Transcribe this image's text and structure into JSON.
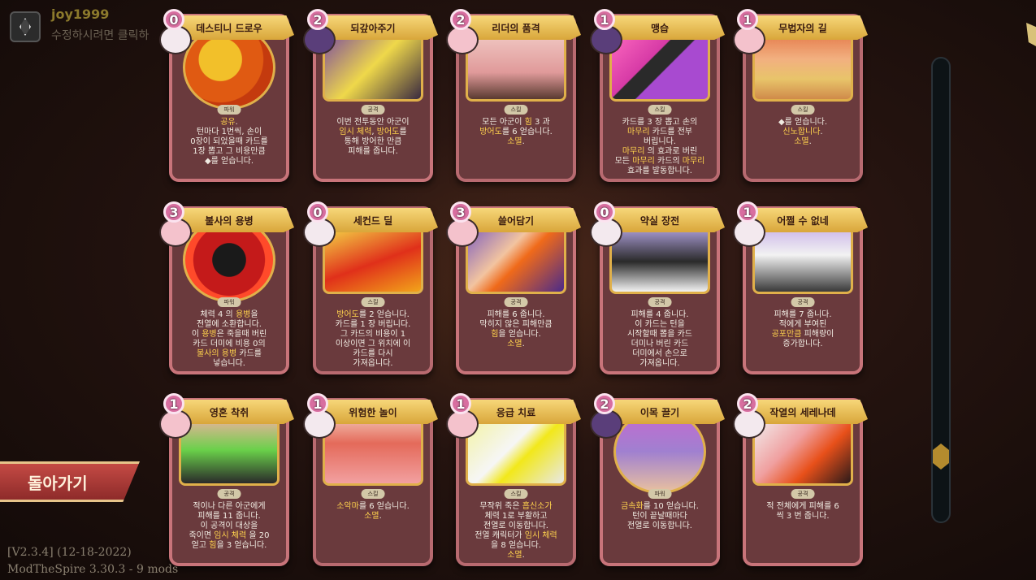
{
  "user": {
    "name": "joy1999",
    "hint": "수정하시려면 클릭하"
  },
  "back_button": "돌아가기",
  "version": {
    "line1": "[V2.3.4] (12-18-2022)",
    "line2": "ModTheSpire 3.30.3 - 9 mods"
  },
  "cards": [
    {
      "title": "데스티니 드로우",
      "cost": "0",
      "type": "파워",
      "desc_lines": [
        "<span class=\"hl\">공유</span>.",
        "턴마다 1번씩, 손이",
        "0장이 되었을때 카드를",
        "1장 뽑고 그 비용만큼",
        "◆를 얻습니다."
      ]
    },
    {
      "title": "되갚아주기",
      "cost": "2",
      "type": "공격",
      "desc_lines": [
        "이번 전투동안 아군이",
        "<span class=\"hl\">임시 체력</span>, <span class=\"hl\">방어도</span>를",
        "통해 방어한 만큼",
        "피해를 줍니다."
      ]
    },
    {
      "title": "리더의 품격",
      "cost": "2",
      "type": "스킬",
      "desc_lines": [
        "모든 아군이 <span class=\"hl\">힘</span> 3 과",
        "<span class=\"hl\">방어도</span>를 6 얻습니다.",
        "<span class=\"hl\">소멸</span>."
      ]
    },
    {
      "title": "맹습",
      "cost": "1",
      "type": "스킬",
      "desc_lines": [
        "카드를 3 장 뽑고 손의",
        "<span class=\"hl\">마무리</span> 카드를 전부",
        "버립니다.",
        "<span class=\"hl\">마무리</span> 의 효과로 버린",
        "모든 <span class=\"hl\">마무리</span> 카드의 <span class=\"hl\">마무리</span>",
        "효과를 발동합니다."
      ]
    },
    {
      "title": "무법자의 길",
      "cost": "1",
      "type": "스킬",
      "desc_lines": [
        "◆를 얻습니다.",
        "<span class=\"hl\">신노합니다</span>.",
        "<span class=\"hl\">소멸</span>."
      ]
    },
    {
      "title": "불사의 용병",
      "cost": "3",
      "type": "파워",
      "desc_lines": [
        "체력 4 의 <span class=\"hl\">용병</span>을",
        "전열에 소환합니다.",
        "이 <span class=\"hl\">용병</span>은 죽을때 버린",
        "카드 더미에 비용 0의",
        "<span class=\"hl\">불사의 용병</span> 카드를",
        "넣습니다."
      ]
    },
    {
      "title": "세컨드 딜",
      "cost": "0",
      "type": "스킬",
      "desc_lines": [
        "<span class=\"hl\">방어도</span>를 2 얻습니다.",
        "카드를 1 장 버립니다.",
        "그 카드의 비용이 1",
        "이상이면 그 위치에 이",
        "카드를 다시",
        "가져옵니다."
      ]
    },
    {
      "title": "쓸어담기",
      "cost": "3",
      "type": "공격",
      "desc_lines": [
        "피해를 6 줍니다.",
        "막히지 않은 피해만큼",
        "<span class=\"hl\">힘</span>을 얻습니다.",
        "<span class=\"hl\">소멸</span>."
      ]
    },
    {
      "title": "약실 장전",
      "cost": "0",
      "type": "공격",
      "desc_lines": [
        "피해를 4 줍니다.",
        "이 카드는 턴을",
        "시작할때 뽑을 카드",
        "더미나 버린 카드",
        "더미에서 손으로",
        "가져옵니다."
      ]
    },
    {
      "title": "어쩔 수 없네",
      "cost": "1",
      "type": "공격",
      "desc_lines": [
        "피해를 7 줍니다.",
        "적에게 부여된",
        "<span class=\"hl\">공포만큼</span> 피해량이",
        "증가합니다."
      ]
    },
    {
      "title": "영혼 착취",
      "cost": "1",
      "type": "공격",
      "desc_lines": [
        "적이나 다른 아군에게",
        "피해를 11 줍니다.",
        "이 공격이 대상을",
        "죽이면 <span class=\"hl\">임시 체력</span> 을 20",
        "얻고 <span class=\"hl\">힘</span>을 3 얻습니다."
      ]
    },
    {
      "title": "위험한 놀이",
      "cost": "1",
      "type": "스킬",
      "desc_lines": [
        "<span class=\"hl\">소악마</span>를 6 얻습니다.",
        "<span class=\"hl\">소멸</span>."
      ]
    },
    {
      "title": "응급 치료",
      "cost": "1",
      "type": "스킬",
      "desc_lines": [
        "무작위 죽은 <span class=\"hl\">흡신소가</span>",
        "체력 1로 부활하고",
        "전열로 이동합니다.",
        "전열 캐릭터가 <span class=\"hl\">임시 체력</span>",
        "을 8 얻습니다.",
        "<span class=\"hl\">소멸</span>."
      ]
    },
    {
      "title": "이목 끌기",
      "cost": "2",
      "type": "파워",
      "desc_lines": [
        "<span class=\"hl\">금속화</span>를 10 얻습니다.",
        "턴이 끝날때마다",
        "전열로 이동합니다."
      ]
    },
    {
      "title": "작열의 세레나데",
      "cost": "2",
      "type": "공격",
      "desc_lines": [
        "적 전체에게 피해를 6",
        "씩 3 번 줍니다."
      ]
    }
  ]
}
